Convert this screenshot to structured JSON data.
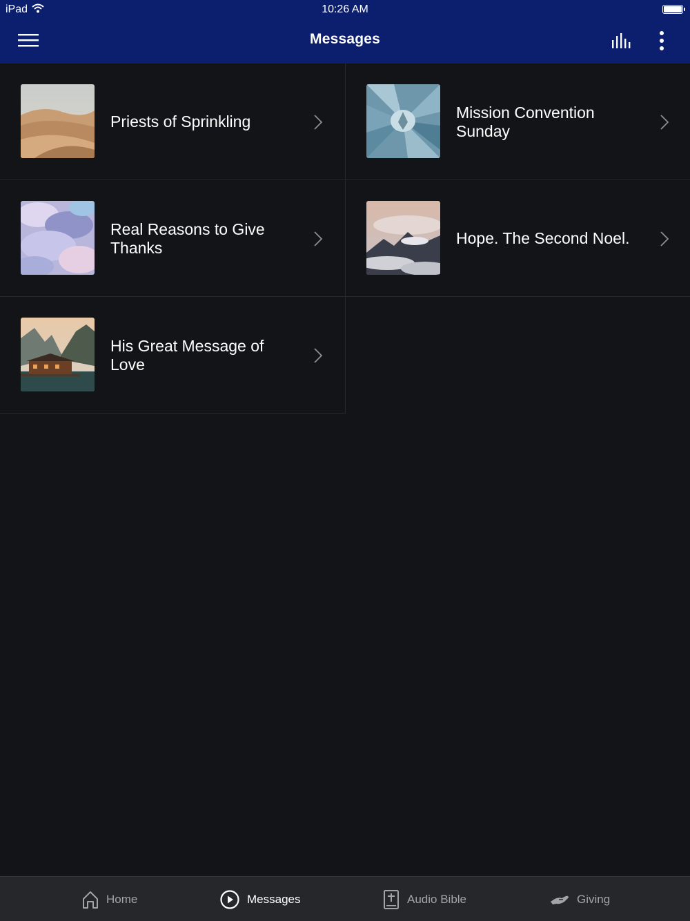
{
  "status_bar": {
    "device": "iPad",
    "time": "10:26 AM"
  },
  "header": {
    "title": "Messages"
  },
  "messages": [
    {
      "title": "Priests of Sprinkling",
      "thumb": "desert-dunes"
    },
    {
      "title": "Mission Convention Sunday",
      "thumb": "agave-succulent"
    },
    {
      "title": "Real Reasons to Give Thanks",
      "thumb": "pastel-clouds"
    },
    {
      "title": "Hope. The Second Noel.",
      "thumb": "mountain-clouds"
    },
    {
      "title": "His Great Message of Love",
      "thumb": "lake-boathouse"
    }
  ],
  "tabbar": {
    "home": "Home",
    "messages": "Messages",
    "audio_bible": "Audio Bible",
    "giving": "Giving"
  },
  "colors": {
    "header_bg": "#0c1f6e",
    "page_bg": "#131417",
    "tabbar_bg": "#26272b",
    "divider": "#26282d"
  }
}
